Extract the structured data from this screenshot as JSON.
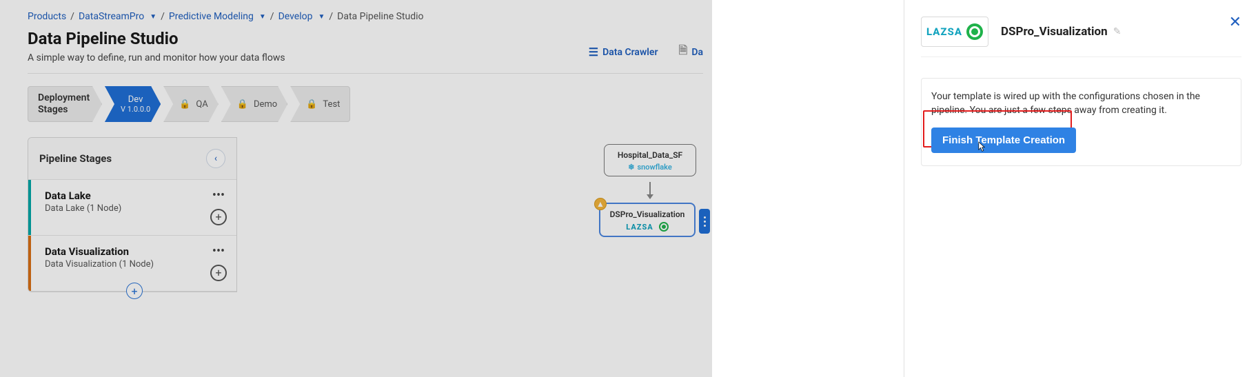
{
  "breadcrumb": {
    "items": [
      {
        "label": "Products",
        "link": true,
        "dropdown": false
      },
      {
        "label": "DataStreamPro",
        "link": true,
        "dropdown": true
      },
      {
        "label": "Predictive Modeling",
        "link": true,
        "dropdown": true
      },
      {
        "label": "Develop",
        "link": true,
        "dropdown": true
      },
      {
        "label": "Data Pipeline Studio",
        "link": false,
        "dropdown": false
      }
    ]
  },
  "header": {
    "title": "Data Pipeline Studio",
    "subtitle": "A simple way to define, run and monitor how your data flows",
    "links": {
      "crawler": "Data Crawler",
      "model": "Da"
    }
  },
  "stages": {
    "label": "Deployment\nStages",
    "items": [
      {
        "name": "Dev",
        "sub": "V 1.0.0.0",
        "active": true
      },
      {
        "name": "QA",
        "locked": true
      },
      {
        "name": "Demo",
        "locked": true
      },
      {
        "name": "Test",
        "locked": true
      }
    ]
  },
  "pipeline": {
    "title": "Pipeline Stages",
    "items": [
      {
        "name": "Data Lake",
        "sub_prefix": "Data Lake ",
        "sub_nodes": "(1 Node)",
        "accent": "teal"
      },
      {
        "name": "Data Visualization",
        "sub_prefix": "Data Visualization ",
        "sub_nodes": "(1 Node)",
        "accent": "orange"
      }
    ]
  },
  "canvas": {
    "node1": {
      "title": "Hospital_Data_SF",
      "vendor": "snowflake"
    },
    "node2": {
      "title": "DSPro_Visualization",
      "vendor": "LAZSA"
    }
  },
  "panel": {
    "title": "DSPro_Visualization",
    "logo": "LAZSA",
    "message": "Your template is wired up with the configurations chosen in the pipeline. You are just a few steps away from creating it.",
    "button": "Finish Template Creation"
  }
}
